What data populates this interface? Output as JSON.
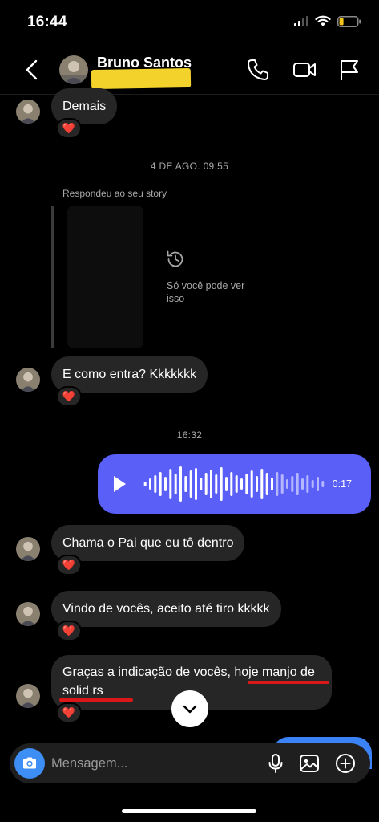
{
  "status_bar": {
    "time": "16:44"
  },
  "header": {
    "contact_name": "Bruno Santos",
    "icons": [
      "back-icon",
      "phone-icon",
      "video-icon",
      "flag-icon"
    ]
  },
  "messages": {
    "m1": {
      "text": "Demais",
      "reaction": "❤️"
    },
    "ts1": "4 DE AGO. 09:55",
    "story": {
      "label": "Respondeu ao seu story",
      "note": "Só você pode ver isso"
    },
    "m2": {
      "text": "E como entra? Kkkkkkk",
      "reaction": "❤️"
    },
    "ts2": "16:32",
    "voice": {
      "duration": "0:17"
    },
    "m3": {
      "text": "Chama o Pai que eu tô dentro",
      "reaction": "❤️"
    },
    "m4": {
      "text": "Vindo de vocês, aceito até tiro kkkkk",
      "reaction": "❤️"
    },
    "m5": {
      "text": "Graças a indicação de vocês, hoje manjo de solid rs",
      "reaction": "❤️"
    }
  },
  "composer": {
    "placeholder": "Mensagem..."
  },
  "colors": {
    "accent": "#5a5ff8",
    "bubble": "#262626",
    "camera": "#3d8ef5",
    "highlight": "#d91919"
  }
}
